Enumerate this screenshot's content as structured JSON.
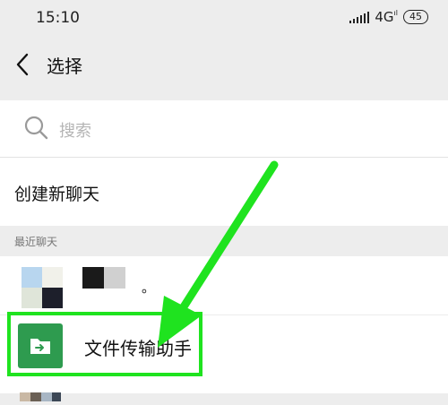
{
  "status_bar": {
    "time": "15:10",
    "network": "4G",
    "network_sup": "ıl",
    "battery": "45"
  },
  "header": {
    "title": "选择"
  },
  "search": {
    "placeholder": "搜索"
  },
  "new_chat": {
    "label": "创建新聊天"
  },
  "section": {
    "recent_label": "最近聊天"
  },
  "contacts": [
    {
      "name": "。",
      "avatar": "group-avatar"
    },
    {
      "name": "文件传输助手",
      "avatar": "file-transfer-icon"
    }
  ],
  "colors": {
    "background": "#ededed",
    "file_transfer_green": "#2e9b4f",
    "annotation_green": "#1fe31f"
  }
}
